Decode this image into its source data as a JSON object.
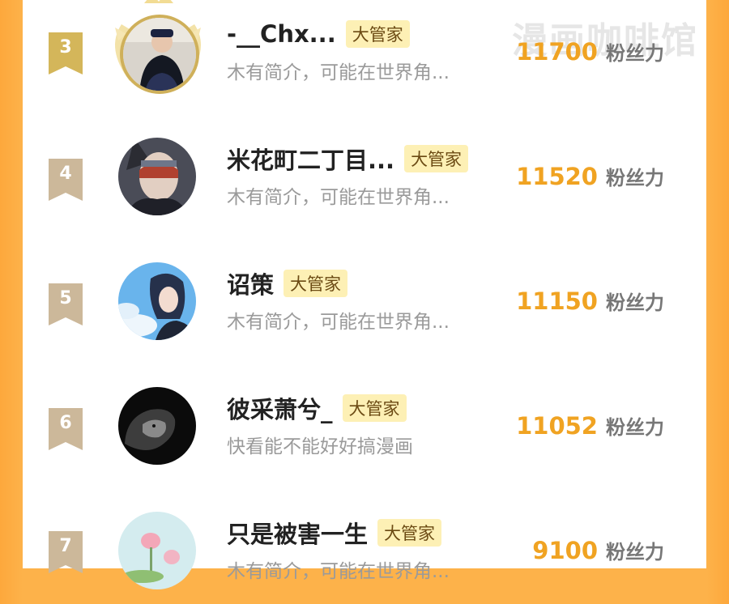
{
  "watermark": "漫画咖啡馆",
  "colors": {
    "accent_orange": "#fdb24a",
    "fans_number": "#f0a322",
    "badge_bg": "#fdf0b5",
    "rank_gold": "#d7bd6a",
    "rank_tan": "#ccb89a"
  },
  "rows": [
    {
      "rank": "3",
      "name": "-__Chx...",
      "badge": "大管家",
      "desc": "木有简介，可能在世界角...",
      "fans": "11700",
      "fans_label": "粉丝力",
      "has_crown": true,
      "avatar_icon": "person-photo"
    },
    {
      "rank": "4",
      "name": "米花町二丁目...",
      "badge": "大管家",
      "desc": "木有简介，可能在世界角...",
      "fans": "11520",
      "fans_label": "粉丝力",
      "has_crown": false,
      "avatar_icon": "masked-character"
    },
    {
      "rank": "5",
      "name": "诏策",
      "badge": "大管家",
      "desc": "木有简介，可能在世界角...",
      "fans": "11150",
      "fans_label": "粉丝力",
      "has_crown": false,
      "avatar_icon": "anime-boy-sky"
    },
    {
      "rank": "6",
      "name": "彼采萧兮_",
      "badge": "大管家",
      "desc": "快看能不能好好搞漫画",
      "fans": "11052",
      "fans_label": "粉丝力",
      "has_crown": false,
      "avatar_icon": "lion-dark"
    },
    {
      "rank": "7",
      "name": "只是被害一生",
      "badge": "大管家",
      "desc": "木有简介，可能在世界角...",
      "fans": "9100",
      "fans_label": "粉丝力",
      "has_crown": false,
      "avatar_icon": "lotus-flowers"
    }
  ]
}
